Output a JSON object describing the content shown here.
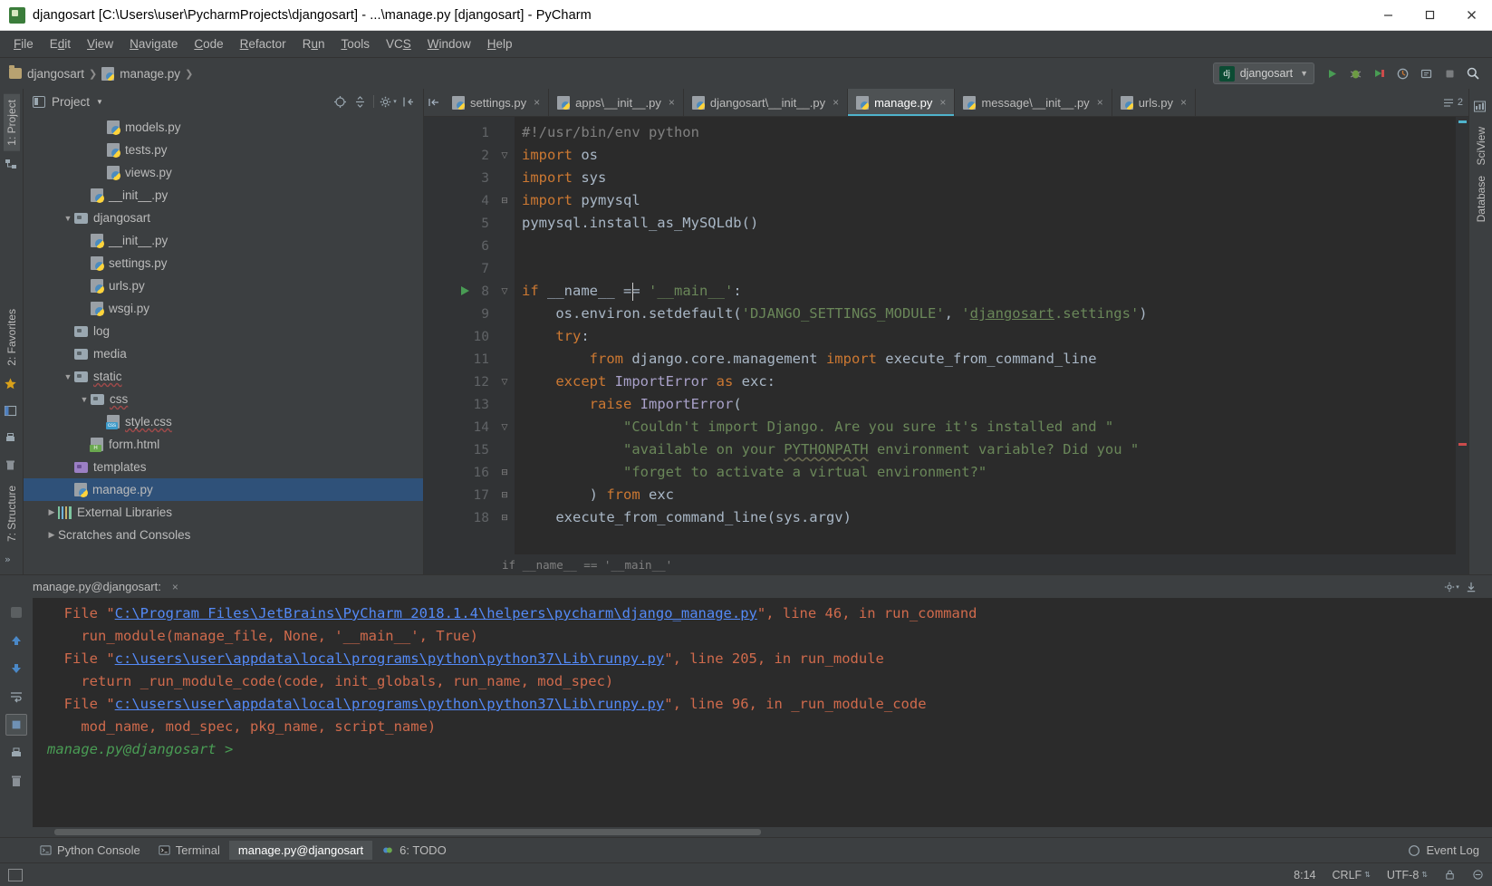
{
  "window": {
    "title": "djangosart [C:\\Users\\user\\PycharmProjects\\djangosart] - ...\\manage.py [djangosart] - PyCharm",
    "app_icon": "pycharm-icon",
    "minimize": "minimize-button",
    "maximize": "maximize-button",
    "close": "close-button"
  },
  "menu": {
    "items": [
      {
        "label": "File"
      },
      {
        "label": "Edit"
      },
      {
        "label": "View"
      },
      {
        "label": "Navigate"
      },
      {
        "label": "Code"
      },
      {
        "label": "Refactor"
      },
      {
        "label": "Run"
      },
      {
        "label": "Tools"
      },
      {
        "label": "VCS"
      },
      {
        "label": "Window"
      },
      {
        "label": "Help"
      }
    ]
  },
  "navbar": {
    "breadcrumb": [
      {
        "label": "djangosart",
        "icon": "folder-icon"
      },
      {
        "label": "manage.py",
        "icon": "python-file-icon"
      }
    ],
    "run_config": {
      "label": "djangosart",
      "badge": "dj"
    },
    "buttons": [
      {
        "name": "run-button"
      },
      {
        "name": "debug-button"
      },
      {
        "name": "coverage-button"
      },
      {
        "name": "profile-button"
      },
      {
        "name": "attach-button"
      },
      {
        "name": "update-button"
      },
      {
        "name": "stop-button"
      },
      {
        "name": "search-everywhere-button"
      }
    ]
  },
  "left_strip": {
    "tabs": [
      {
        "label": "1: Project",
        "selected": true
      }
    ],
    "icons": [
      {
        "name": "structure-icon"
      }
    ]
  },
  "left_strip_bottom": {
    "tabs": [
      {
        "label": "2: Favorites"
      },
      {
        "label": "7: Structure"
      }
    ]
  },
  "right_strip": {
    "tabs": [
      {
        "label": "SciView"
      },
      {
        "label": "Database"
      }
    ]
  },
  "project_panel": {
    "title": "Project",
    "header_buttons": [
      {
        "name": "locate-file-button"
      },
      {
        "name": "collapse-all-button"
      },
      {
        "name": "settings-gear-button"
      },
      {
        "name": "hide-panel-button"
      }
    ],
    "tree": [
      {
        "label": "models.py",
        "indent": 4,
        "icon": "python-file-icon",
        "arrow": "",
        "selected": false
      },
      {
        "label": "tests.py",
        "indent": 4,
        "icon": "python-file-icon",
        "arrow": "",
        "selected": false
      },
      {
        "label": "views.py",
        "indent": 4,
        "icon": "python-file-icon",
        "arrow": "",
        "selected": false
      },
      {
        "label": "__init__.py",
        "indent": 3,
        "icon": "python-file-icon",
        "arrow": "",
        "selected": false
      },
      {
        "label": "djangosart",
        "indent": 2,
        "icon": "folder-icon",
        "arrow": "▼",
        "selected": false
      },
      {
        "label": "__init__.py",
        "indent": 3,
        "icon": "python-file-icon",
        "arrow": "",
        "selected": false
      },
      {
        "label": "settings.py",
        "indent": 3,
        "icon": "python-file-icon",
        "arrow": "",
        "selected": false
      },
      {
        "label": "urls.py",
        "indent": 3,
        "icon": "python-file-icon",
        "arrow": "",
        "selected": false
      },
      {
        "label": "wsgi.py",
        "indent": 3,
        "icon": "python-file-icon",
        "arrow": "",
        "selected": false
      },
      {
        "label": "log",
        "indent": 2,
        "icon": "folder-icon",
        "arrow": "",
        "selected": false
      },
      {
        "label": "media",
        "indent": 2,
        "icon": "folder-icon",
        "arrow": "",
        "selected": false
      },
      {
        "label": "static",
        "indent": 2,
        "icon": "folder-icon",
        "arrow": "▼",
        "selected": false,
        "spell": true
      },
      {
        "label": "css",
        "indent": 3,
        "icon": "folder-icon",
        "arrow": "▼",
        "selected": false,
        "spell": true
      },
      {
        "label": "style.css",
        "indent": 4,
        "icon": "css-file-icon",
        "arrow": "",
        "selected": false,
        "spell": true
      },
      {
        "label": "form.html",
        "indent": 3,
        "icon": "html-file-icon",
        "arrow": "",
        "selected": false
      },
      {
        "label": "templates",
        "indent": 2,
        "icon": "folder-icon-purple",
        "arrow": "",
        "selected": false
      },
      {
        "label": "manage.py",
        "indent": 2,
        "icon": "python-file-icon",
        "arrow": "",
        "selected": true
      },
      {
        "label": "External Libraries",
        "indent": 1,
        "icon": "library-icon",
        "arrow": "▶",
        "selected": false
      },
      {
        "label": "Scratches and Consoles",
        "indent": 1,
        "icon": "",
        "arrow": "▶",
        "selected": false
      }
    ]
  },
  "editor": {
    "tabs": [
      {
        "label": "settings.py",
        "active": false
      },
      {
        "label": "apps\\__init__.py",
        "active": false
      },
      {
        "label": "djangosart\\__init__.py",
        "active": false
      },
      {
        "label": "manage.py",
        "active": true
      },
      {
        "label": "message\\__init__.py",
        "active": false
      },
      {
        "label": "urls.py",
        "active": false
      }
    ],
    "tab_right_info": "2",
    "breadcrumb": "if __name__ == '__main__'",
    "line_numbers": [
      1,
      2,
      3,
      4,
      5,
      6,
      7,
      8,
      9,
      10,
      11,
      12,
      13,
      14,
      15,
      16,
      17,
      18
    ],
    "lines": [
      {
        "n": 1,
        "text": "#!/usr/bin/env python"
      },
      {
        "n": 2,
        "text": "import os"
      },
      {
        "n": 3,
        "text": "import sys"
      },
      {
        "n": 4,
        "text": "import pymysql"
      },
      {
        "n": 5,
        "text": "pymysql.install_as_MySQLdb()"
      },
      {
        "n": 6,
        "text": ""
      },
      {
        "n": 7,
        "text": ""
      },
      {
        "n": 8,
        "text": "if __name__ == '__main__':"
      },
      {
        "n": 9,
        "text": "    os.environ.setdefault('DJANGO_SETTINGS_MODULE', 'djangosart.settings')"
      },
      {
        "n": 10,
        "text": "    try:"
      },
      {
        "n": 11,
        "text": "        from django.core.management import execute_from_command_line"
      },
      {
        "n": 12,
        "text": "    except ImportError as exc:"
      },
      {
        "n": 13,
        "text": "        raise ImportError("
      },
      {
        "n": 14,
        "text": "            \"Couldn't import Django. Are you sure it's installed and \""
      },
      {
        "n": 15,
        "text": "            \"available on your PYTHONPATH environment variable? Did you \""
      },
      {
        "n": 16,
        "text": "            \"forget to activate a virtual environment?\""
      },
      {
        "n": 17,
        "text": "        ) from exc"
      },
      {
        "n": 18,
        "text": "    execute_from_command_line(sys.argv)"
      }
    ]
  },
  "console": {
    "title": "manage.py@djangosart:",
    "close_label": "×",
    "tools": [
      {
        "name": "rerun-button"
      },
      {
        "name": "scroll-up-button"
      },
      {
        "name": "scroll-down-button"
      },
      {
        "name": "soft-wrap-button"
      },
      {
        "name": "pin-tab-button"
      },
      {
        "name": "print-button"
      },
      {
        "name": "clear-all-button"
      }
    ],
    "header_buttons": [
      {
        "name": "console-settings-button"
      },
      {
        "name": "console-export-button"
      }
    ],
    "output": [
      {
        "parts": [
          {
            "t": "  File \"",
            "k": "err"
          },
          {
            "t": "C:\\Program Files\\JetBrains\\PyCharm 2018.1.4\\helpers\\pycharm\\django_manage.py",
            "k": "path"
          },
          {
            "t": "\", line 46, in run_command",
            "k": "err"
          }
        ]
      },
      {
        "parts": [
          {
            "t": "    run_module(manage_file, None, '__main__', True)",
            "k": "err"
          }
        ]
      },
      {
        "parts": [
          {
            "t": "  File \"",
            "k": "err"
          },
          {
            "t": "c:\\users\\user\\appdata\\local\\programs\\python\\python37\\Lib\\runpy.py",
            "k": "path"
          },
          {
            "t": "\", line 205, in run_module",
            "k": "err"
          }
        ]
      },
      {
        "parts": [
          {
            "t": "    return _run_module_code(code, init_globals, run_name, mod_spec)",
            "k": "err"
          }
        ]
      },
      {
        "parts": [
          {
            "t": "  File \"",
            "k": "err"
          },
          {
            "t": "c:\\users\\user\\appdata\\local\\programs\\python\\python37\\Lib\\runpy.py",
            "k": "path"
          },
          {
            "t": "\", line 96, in _run_module_code",
            "k": "err"
          }
        ]
      },
      {
        "parts": [
          {
            "t": "    mod_name, mod_spec, pkg_name, script_name)",
            "k": "err"
          }
        ]
      },
      {
        "parts": [
          {
            "t": "manage.py@djangosart > ",
            "k": "prompt"
          }
        ]
      }
    ]
  },
  "bottom_bar": {
    "tabs": [
      {
        "label": "Python Console",
        "icon": "python-console-icon",
        "selected": false
      },
      {
        "label": "Terminal",
        "icon": "terminal-icon",
        "selected": false
      },
      {
        "label": "manage.py@djangosart",
        "icon": "",
        "selected": true
      },
      {
        "label": "6: TODO",
        "icon": "todo-icon",
        "selected": false
      }
    ],
    "event_log": {
      "label": "Event Log",
      "icon": "event-log-icon"
    }
  },
  "status_bar": {
    "position": "8:14",
    "line_separator": "CRLF",
    "encoding": "UTF-8",
    "lock_icon": "lock-icon",
    "inspection_icon": "inspection-icon"
  },
  "colors": {
    "accent": "#4fb3cc",
    "selection": "#2f5179",
    "keyword": "#cc7832",
    "string": "#6a8759",
    "error": "#cf6a4c",
    "link": "#548af7",
    "prompt": "#499c54"
  }
}
